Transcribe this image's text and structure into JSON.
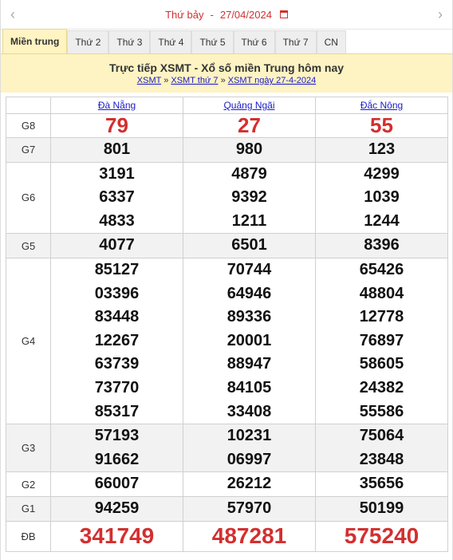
{
  "datebar": {
    "day": "Thứ bảy",
    "sep": "-",
    "date": "27/04/2024",
    "prev_icon": "chevron-left-icon",
    "next_icon": "chevron-right-icon",
    "calendar_icon": "calendar-icon"
  },
  "tabs": [
    "Miền trung",
    "Thứ 2",
    "Thứ 3",
    "Thứ 4",
    "Thứ 5",
    "Thứ 6",
    "Thứ 7",
    "CN"
  ],
  "banner": {
    "title": "Trực tiếp XSMT - Xổ số miền Trung hôm nay",
    "crumbs": [
      "XSMT",
      "XSMT thứ 7",
      "XSMT ngày 27-4-2024"
    ],
    "crumb_sep": "»"
  },
  "table": {
    "provinces": [
      "Đà Nẵng",
      "Quảng Ngãi",
      "Đắc Nông"
    ],
    "prizes": [
      {
        "label": "G8",
        "values": [
          [
            "79"
          ],
          [
            "27"
          ],
          [
            "55"
          ]
        ]
      },
      {
        "label": "G7",
        "values": [
          [
            "801"
          ],
          [
            "980"
          ],
          [
            "123"
          ]
        ]
      },
      {
        "label": "G6",
        "values": [
          [
            "3191",
            "6337",
            "4833"
          ],
          [
            "4879",
            "9392",
            "1211"
          ],
          [
            "4299",
            "1039",
            "1244"
          ]
        ]
      },
      {
        "label": "G5",
        "values": [
          [
            "4077"
          ],
          [
            "6501"
          ],
          [
            "8396"
          ]
        ]
      },
      {
        "label": "G4",
        "values": [
          [
            "85127",
            "03396",
            "83448",
            "12267",
            "63739",
            "73770",
            "85317"
          ],
          [
            "70744",
            "64946",
            "89336",
            "20001",
            "88947",
            "84105",
            "33408"
          ],
          [
            "65426",
            "48804",
            "12778",
            "76897",
            "58605",
            "24382",
            "55586"
          ]
        ]
      },
      {
        "label": "G3",
        "values": [
          [
            "57193",
            "91662"
          ],
          [
            "10231",
            "06997"
          ],
          [
            "75064",
            "23848"
          ]
        ]
      },
      {
        "label": "G2",
        "values": [
          [
            "66007"
          ],
          [
            "26212"
          ],
          [
            "35656"
          ]
        ]
      },
      {
        "label": "G1",
        "values": [
          [
            "94259"
          ],
          [
            "57970"
          ],
          [
            "50199"
          ]
        ]
      },
      {
        "label": "ĐB",
        "values": [
          [
            "341749"
          ],
          [
            "487281"
          ],
          [
            "575240"
          ]
        ]
      }
    ]
  },
  "colors": {
    "accent": "#d32f2f",
    "link": "#1a1ac9",
    "banner_bg": "#fdf3c3",
    "alt_row": "#f2f2f2"
  }
}
